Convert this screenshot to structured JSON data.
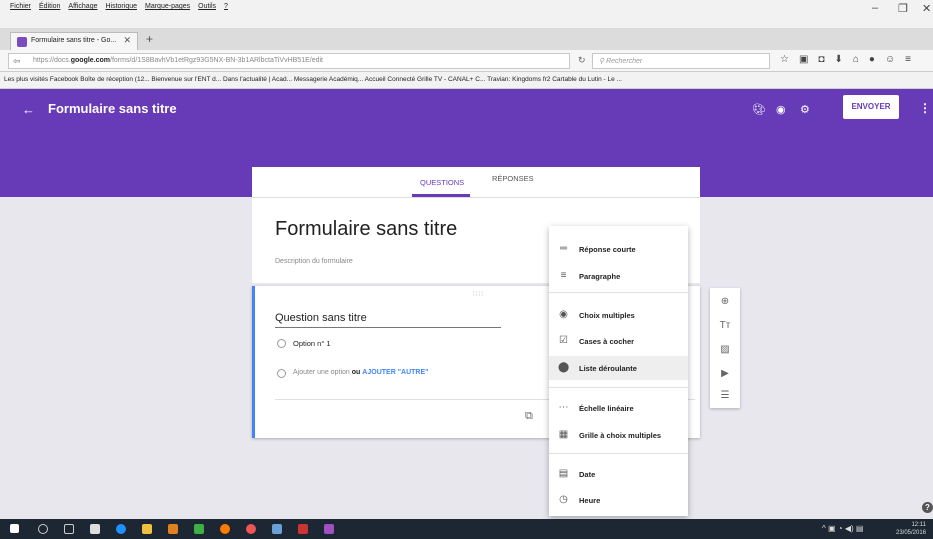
{
  "browser": {
    "menu": [
      "Fichier",
      "Édition",
      "Affichage",
      "Historique",
      "Marque-pages",
      "Outils",
      "?"
    ],
    "tab_title": "Formulaire sans titre - Go...",
    "url_prefix": "https://docs.",
    "url_domain": "google.com",
    "url_path": "/forms/d/1S8BavhVb1etRgz93G5NX-BN-3b1ARlbctaTiVvHB51E/edit",
    "search_placeholder": "Rechercher",
    "bookmarks": "Les plus visités   Facebook   Boîte de réception (12...   Bienvenue sur l'ENT d...   Dans l'actualité | Acad...   Messagerie Académiq...   Accueil Connecté   Grille TV - CANAL+ C...   Travian: Kingdoms fr2   Cartable du Lutin - Le ..."
  },
  "header": {
    "title": "Formulaire sans titre",
    "send_label": "ENVOYER",
    "color": "#673ab7"
  },
  "tabs": {
    "questions": "QUESTIONS",
    "responses": "RÉPONSES"
  },
  "form": {
    "title": "Formulaire sans titre",
    "description_placeholder": "Description du formulaire"
  },
  "question": {
    "title": "Question sans titre",
    "option1": "Option n° 1",
    "add_option": "Ajouter une option",
    "or": "ou",
    "add_other": "AJOUTER \"AUTRE\""
  },
  "dropdown": {
    "items": [
      {
        "label": "Réponse courte",
        "icon": "short-answer-icon"
      },
      {
        "label": "Paragraphe",
        "icon": "paragraph-icon"
      },
      {
        "label": "Choix multiples",
        "icon": "radio-icon"
      },
      {
        "label": "Cases à cocher",
        "icon": "checkbox-icon"
      },
      {
        "label": "Liste déroulante",
        "icon": "dropdown-icon"
      },
      {
        "label": "Échelle linéaire",
        "icon": "linear-scale-icon"
      },
      {
        "label": "Grille à choix multiples",
        "icon": "grid-icon"
      },
      {
        "label": "Date",
        "icon": "calendar-icon"
      },
      {
        "label": "Heure",
        "icon": "clock-icon"
      }
    ]
  },
  "taskbar": {
    "time": "12:11",
    "date": "23/05/2016"
  }
}
